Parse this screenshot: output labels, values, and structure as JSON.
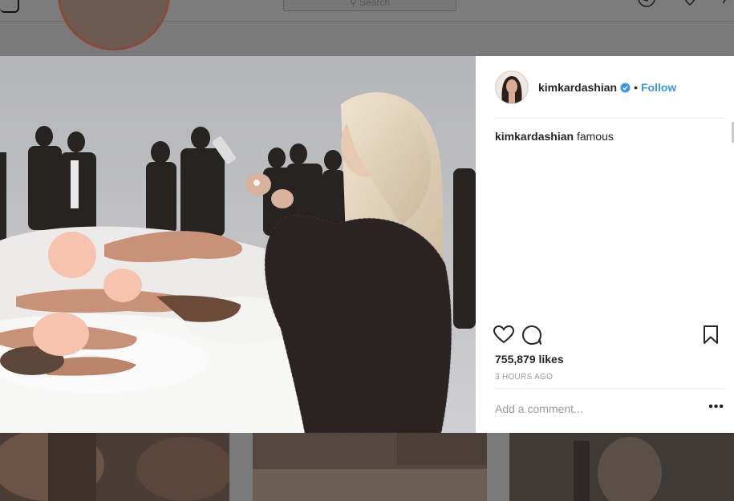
{
  "search": {
    "placeholder": "Search"
  },
  "post": {
    "username": "kimkardashian",
    "follow_label": "Follow",
    "separator": "•",
    "caption": {
      "username": "kimkardashian",
      "text": "famous"
    },
    "likes": "755,879 likes",
    "timestamp": "3 HOURS AGO",
    "comment_placeholder": "Add a comment...",
    "more_label": "•••"
  },
  "colors": {
    "link_blue": "#3897f0",
    "verified_blue": "#3897f0",
    "text": "#262626",
    "muted": "#999999"
  },
  "icons": [
    "instagram-logo-icon",
    "search-icon",
    "compass-icon",
    "heart-icon",
    "user-icon",
    "verified-badge-icon",
    "like-heart-icon",
    "comment-icon",
    "bookmark-icon"
  ]
}
